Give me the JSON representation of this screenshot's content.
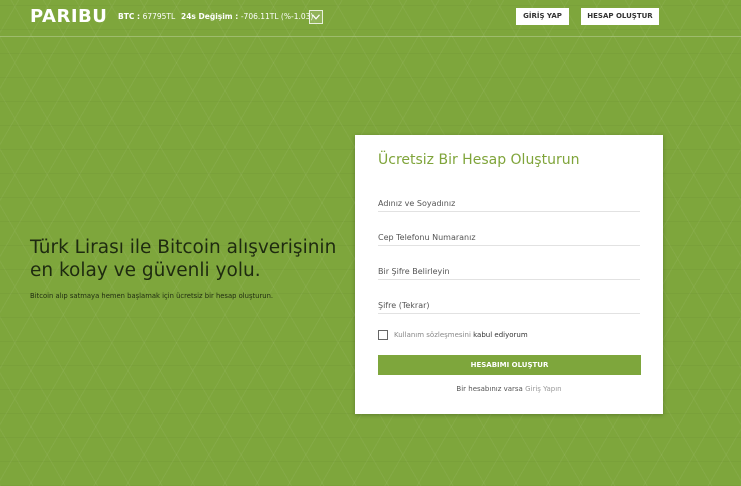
{
  "header": {
    "logo": "PARIBU",
    "btc_label": "BTC : ",
    "btc_value": "67795TL",
    "change_label": "24s Değişim : ",
    "change_value": "-706.11TL (%-1.03)",
    "login_label": "GİRİŞ YAP",
    "register_label": "HESAP OLUŞTUR"
  },
  "hero": {
    "title_line1": "Türk Lirası ile Bitcoin alışverişinin",
    "title_line2": "en kolay ve güvenli yolu.",
    "subtitle": "Bitcoin alıp satmaya hemen başlamak için ücretsiz bir hesap oluşturun."
  },
  "form": {
    "title": "Ücretsiz Bir Hesap Oluşturun",
    "name_placeholder": "Adınız ve Soyadınız",
    "phone_placeholder": "Cep Telefonu Numaranız",
    "password_placeholder": "Bir Şifre Belirleyin",
    "password_repeat_placeholder": "Şifre (Tekrar)",
    "terms_link": "Kullanım sözleşmesini",
    "terms_accept": "kabul ediyorum",
    "submit_label": "HESABIMI OLUŞTUR",
    "login_prompt": "Bir hesabınız varsa",
    "login_link": "Giriş Yapın"
  },
  "colors": {
    "brand_green": "#7ea63c",
    "title_green": "#7fa43a"
  }
}
